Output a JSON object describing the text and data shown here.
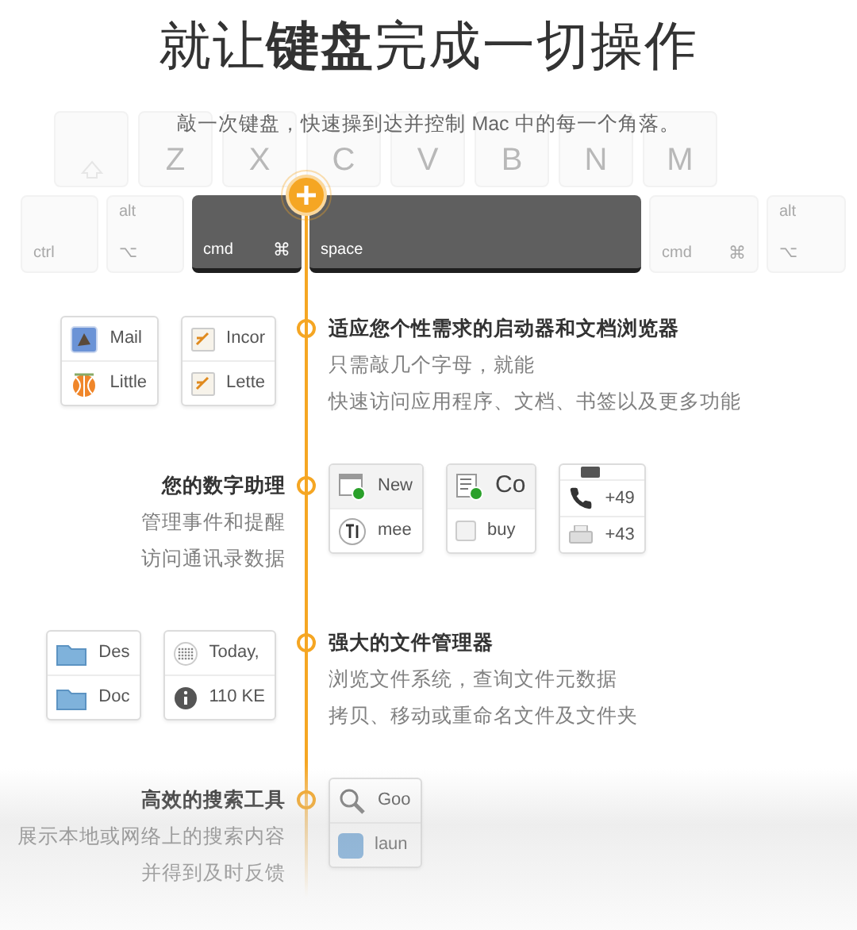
{
  "title": "就让**键盘**完成一切操作",
  "subtitle": "敲一次键盘，快速操到达并控制 Mac 中的每一个角落。",
  "keyboard": {
    "letter_row": [
      {
        "kind": "shift"
      },
      {
        "label": "Z"
      },
      {
        "label": "X"
      },
      {
        "label": "C"
      },
      {
        "label": "V"
      },
      {
        "label": "B"
      },
      {
        "label": "N"
      },
      {
        "label": "M"
      }
    ],
    "bottom_row": [
      {
        "label": "ctrl",
        "active": false
      },
      {
        "top": "alt",
        "label": "⌥",
        "active": false
      },
      {
        "label": "cmd",
        "symbol": "⌘",
        "active": true
      },
      {
        "label": "space",
        "active": true
      },
      {
        "label": "cmd",
        "symbol": "⌘",
        "active": false
      },
      {
        "top": "alt",
        "label": "⌥",
        "active": false
      }
    ]
  },
  "sections": [
    {
      "title": "适应您个性需求的启动器和文档浏览器",
      "lines": [
        "只需敲几个字母，就能",
        "快速访问应用程序、文档、书签以及更多功能"
      ],
      "cards": [
        {
          "kind": "list",
          "rows": [
            {
              "kind": "mail",
              "text": "Mail"
            },
            {
              "kind": "ball",
              "text": "Little"
            }
          ]
        },
        {
          "kind": "list",
          "rows": [
            {
              "kind": "note",
              "text": "Incor"
            },
            {
              "kind": "note",
              "text": "Lette"
            }
          ]
        }
      ]
    },
    {
      "title": "您的数字助理",
      "lines": [
        "管理事件和提醒",
        "访问通讯录数据"
      ],
      "cards": [
        {
          "kind": "header",
          "rows": [
            {
              "kind": "calendar",
              "text": "New"
            },
            {
              "kind": "text-cursor",
              "text": "mee"
            }
          ]
        },
        {
          "kind": "header",
          "rows": [
            {
              "kind": "checklist",
              "text": "Co"
            },
            {
              "kind": "checkbox",
              "text": "buy"
            }
          ]
        },
        {
          "kind": "contact",
          "rows": [
            {
              "kind": "device"
            },
            {
              "kind": "phone",
              "text": "+49"
            },
            {
              "kind": "printer",
              "text": "+43"
            }
          ]
        }
      ]
    },
    {
      "title": "强大的文件管理器",
      "lines": [
        "浏览文件系统，查询文件元数据",
        "拷贝、移动或重命名文件及文件夹"
      ],
      "cards": [
        {
          "kind": "list",
          "rows": [
            {
              "kind": "folder",
              "text": "Des"
            },
            {
              "kind": "folder",
              "text": "Doc"
            }
          ]
        },
        {
          "kind": "list",
          "rows": [
            {
              "kind": "dots",
              "text": "Today,"
            },
            {
              "kind": "info",
              "text": "110 KE"
            }
          ]
        }
      ]
    },
    {
      "title": "高效的搜索工具",
      "lines": [
        "展示本地或网络上的搜索内容",
        "并得到及时反馈"
      ],
      "cards": [
        {
          "kind": "list",
          "rows": [
            {
              "kind": "search",
              "text": "Goo"
            },
            {
              "kind": "blue-app",
              "text": "laun"
            }
          ]
        }
      ]
    }
  ]
}
